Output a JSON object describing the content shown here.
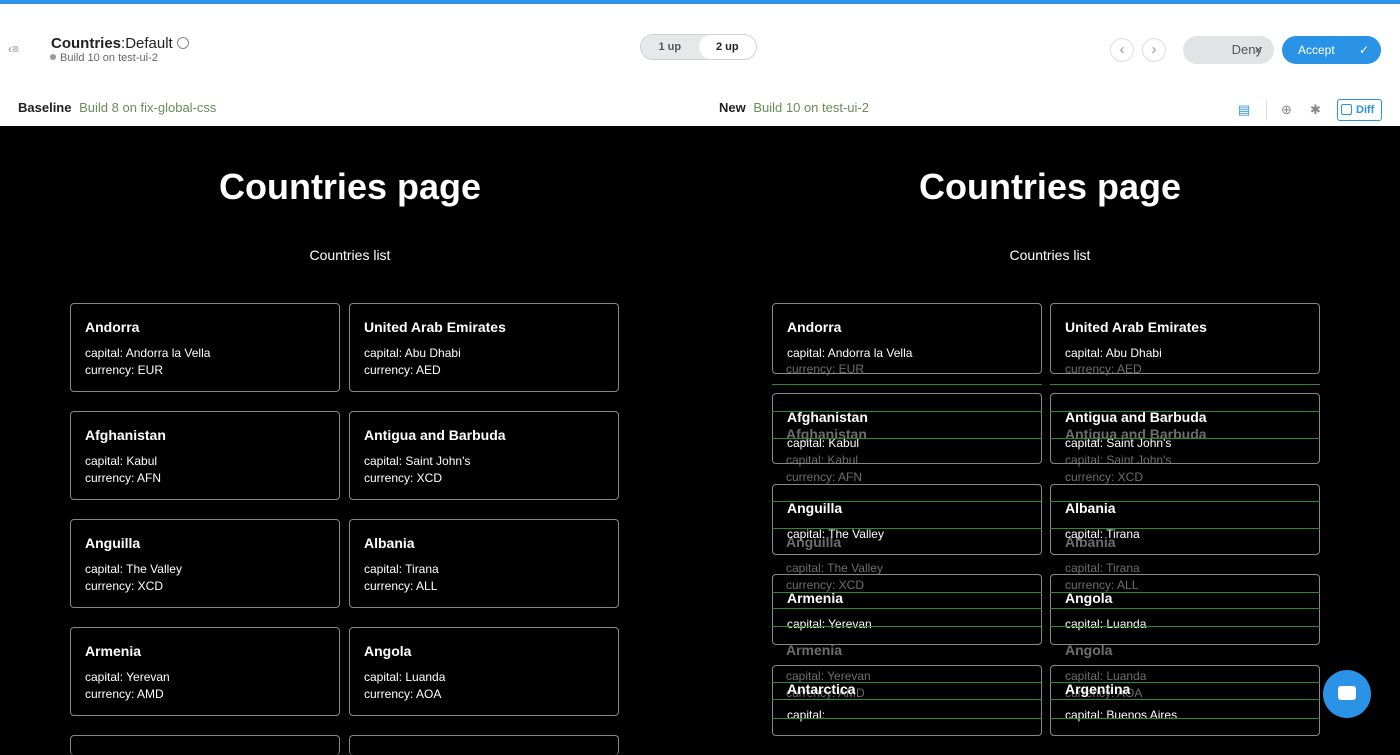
{
  "header": {
    "title_bold": "Countries",
    "title_sep": ":",
    "title_rest": "Default",
    "subtitle": "Build 10 on test-ui-2",
    "toggle": [
      "1 up",
      "2 up"
    ],
    "deny_label": "Deny",
    "deny_icon": "×",
    "accept_label": "Accept",
    "accept_icon": "✓",
    "baseline_label": "Baseline",
    "baseline_value": "Build 8 on fix-global-css",
    "new_label": "New",
    "new_value": "Build 10 on test-ui-2",
    "diff_label": "Diff"
  },
  "page": {
    "title": "Countries page",
    "subtitle": "Countries list"
  },
  "baseline_cards": [
    {
      "name": "Andorra",
      "capital": "capital: Andorra la Vella",
      "currency": "currency: EUR"
    },
    {
      "name": "United Arab Emirates",
      "capital": "capital: Abu Dhabi",
      "currency": "currency: AED"
    },
    {
      "name": "Afghanistan",
      "capital": "capital: Kabul",
      "currency": "currency: AFN"
    },
    {
      "name": "Antigua and Barbuda",
      "capital": "capital: Saint John's",
      "currency": "currency: XCD"
    },
    {
      "name": "Anguilla",
      "capital": "capital: The Valley",
      "currency": "currency: XCD"
    },
    {
      "name": "Albania",
      "capital": "capital: Tirana",
      "currency": "currency: ALL"
    },
    {
      "name": "Armenia",
      "capital": "capital: Yerevan",
      "currency": "currency: AMD"
    },
    {
      "name": "Angola",
      "capital": "capital: Luanda",
      "currency": "currency: AOA"
    }
  ],
  "new_cards": [
    {
      "name": "Andorra",
      "capital": "capital: Andorra la Vella"
    },
    {
      "name": "United Arab Emirates",
      "capital": "capital: Abu Dhabi"
    },
    {
      "name": "Afghanistan",
      "capital": "capital: Kabul"
    },
    {
      "name": "Antigua and Barbuda",
      "capital": "capital: Saint John's"
    },
    {
      "name": "Anguilla",
      "capital": "capital: The Valley"
    },
    {
      "name": "Albania",
      "capital": "capital: Tirana"
    },
    {
      "name": "Armenia",
      "capital": "capital: Yerevan"
    },
    {
      "name": "Angola",
      "capital": "capital: Luanda"
    },
    {
      "name": "Antarctica",
      "capital": "capital:"
    },
    {
      "name": "Argentina",
      "capital": "capital: Buenos Aires"
    }
  ],
  "ghost": {
    "currency_eur": "currency: EUR",
    "currency_aed": "currency: AED",
    "afghanistan": "Afghanistan",
    "antigua": "Antigua and Barbuda",
    "capital_kabul": "capital: Kabul",
    "capital_stjohns": "capital: Saint John's",
    "currency_afn": "currency: AFN",
    "currency_xcd": "currency: XCD",
    "anguilla": "Anguilla",
    "albania": "Albania",
    "capital_valley": "capital: The Valley",
    "capital_tirana": "capital: Tirana",
    "currency_xcd2": "currency: XCD",
    "currency_all": "currency: ALL",
    "armenia": "Armenia",
    "angola": "Angola",
    "capital_yerevan": "capital: Yerevan",
    "capital_luanda": "capital: Luanda",
    "currency_amd": "currency: AMD",
    "currency_aoa": "currency: AOA"
  }
}
